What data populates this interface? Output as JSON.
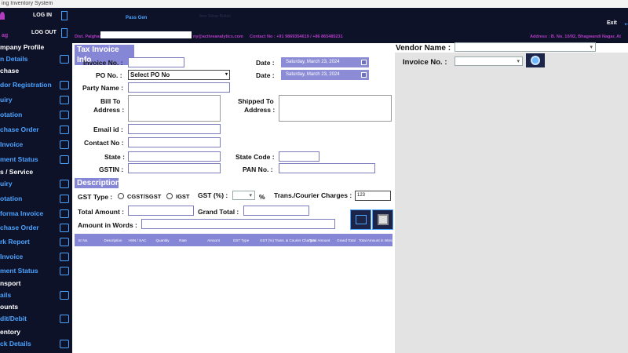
{
  "window": {
    "title": "ing Inventory System"
  },
  "header": {
    "log_in": "LOG IN",
    "log_out": "LOG OUT",
    "user_tag": "ag",
    "pass_gen": "Pass Gen",
    "faded_link": "Item Setup Button",
    "exit": "Exit",
    "info_prefix": "Dist. Palghar",
    "email_text": "ny@activeanalytics.com",
    "contact_text": "Contact No :  +91 9869354619 / +86 865485231",
    "address_text": "Address :  B. No. 10/92, Bhagwandi Nagar, At"
  },
  "sidebar": {
    "items": [
      {
        "label": "mpany Profile",
        "kind": "head"
      },
      {
        "label": "n Details",
        "kind": "item"
      },
      {
        "label": "chase",
        "kind": "head"
      },
      {
        "label": "dor Registration",
        "kind": "item"
      },
      {
        "label": "uiry",
        "kind": "item"
      },
      {
        "label": "otation",
        "kind": "item"
      },
      {
        "label": "chase Order",
        "kind": "item"
      },
      {
        "label": "Invoice",
        "kind": "item"
      },
      {
        "label": "ment Status",
        "kind": "item"
      },
      {
        "label": "s /  Service",
        "kind": "head"
      },
      {
        "label": "uiry",
        "kind": "item"
      },
      {
        "label": "otation",
        "kind": "item"
      },
      {
        "label": "forma Invoice",
        "kind": "item"
      },
      {
        "label": "chase Order",
        "kind": "item"
      },
      {
        "label": "rk Report",
        "kind": "item"
      },
      {
        "label": "Invoice",
        "kind": "item"
      },
      {
        "label": "ment Status",
        "kind": "item"
      },
      {
        "label": "nsport",
        "kind": "head"
      },
      {
        "label": "ails",
        "kind": "item"
      },
      {
        "label": "ounts",
        "kind": "head"
      },
      {
        "label": "dit/Debit",
        "kind": "item"
      },
      {
        "label": "entory",
        "kind": "head"
      },
      {
        "label": "ck Details",
        "kind": "item"
      }
    ]
  },
  "form": {
    "section_title": "Tax Invoice Info",
    "invoice_no_label": "Invoice No. :",
    "invoice_no_value": "",
    "po_no_label": "PO No. :",
    "po_no_value": "Select PO No",
    "date_label": "Date :",
    "date1_value": "Saturday,  March 23, 2024",
    "date2_value": "Saturday,  March 23, 2024",
    "party_name_label": "Party Name :",
    "bill_to_label1": "Bill To",
    "bill_to_label2": "Address :",
    "shipped_to_label1": "Shipped To",
    "shipped_to_label2": "Address :",
    "email_label": "Email id :",
    "contact_label": "Contact No :",
    "state_label": "State :",
    "state_code_label": "State Code :",
    "gstin_label": "GSTIN :",
    "pan_label": "PAN No. :"
  },
  "description": {
    "section_title": "Description",
    "gst_type_label": "GST Type :",
    "cgst_sgst_label": "CGST/SGST",
    "igst_label": "IGST",
    "gst_pct_label": "GST (%) :",
    "pct_symbol": "%",
    "trans_label": "Trans./Courier Charges :",
    "trans_value": "123",
    "total_amount_label": "Total Amount :",
    "grand_total_label": "Grand Total :",
    "amount_words_label": "Amount in Words :"
  },
  "table": {
    "columns": [
      "Sr No.",
      "Description",
      "HSN / SAC",
      "Quantity",
      "Rate",
      "Amount",
      "GST Type",
      "GST (%)",
      "Trans. & Courier Charges",
      "Total Amount",
      "Grand Total",
      "Total Amount in Words"
    ]
  },
  "vendor": {
    "vendor_name_label": "Vendor Name :",
    "invoice_no_label": "Invoice No. :"
  },
  "colors": {
    "sidebar_bg": "#0e1229",
    "accent_blue": "#4aa3ff",
    "section_purple": "#8686d6",
    "header_magenta": "#b23cc2"
  }
}
